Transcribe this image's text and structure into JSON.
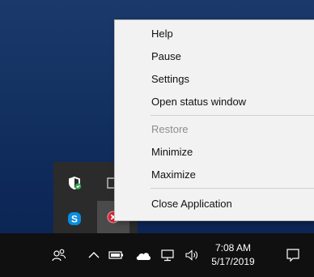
{
  "context_menu": {
    "items": [
      {
        "label": "Help",
        "enabled": true
      },
      {
        "label": "Pause",
        "enabled": true
      },
      {
        "label": "Settings",
        "enabled": true
      },
      {
        "label": "Open status window",
        "enabled": true
      },
      {
        "label": "Restore",
        "enabled": false
      },
      {
        "label": "Minimize",
        "enabled": true
      },
      {
        "label": "Maximize",
        "enabled": true
      },
      {
        "label": "Close Application",
        "enabled": true
      }
    ]
  },
  "tray_overflow": {
    "icons": [
      "windows-security-icon",
      "window-icon",
      "skype-icon",
      "app-status-icon"
    ]
  },
  "taskbar": {
    "icons": [
      "people-icon",
      "chevron-up-icon",
      "battery-icon",
      "onedrive-cloud-icon",
      "network-icon",
      "volume-icon",
      "notifications-icon"
    ]
  },
  "clock": {
    "time": "7:08 AM",
    "date": "5/17/2019"
  },
  "colors": {
    "desktop": "#0f2c5c",
    "taskbar": "#101010",
    "menu_bg": "#f2f2f2",
    "skype_blue": "#0a8ddf",
    "security_green": "#2fa84f",
    "error_red": "#d8243a"
  }
}
